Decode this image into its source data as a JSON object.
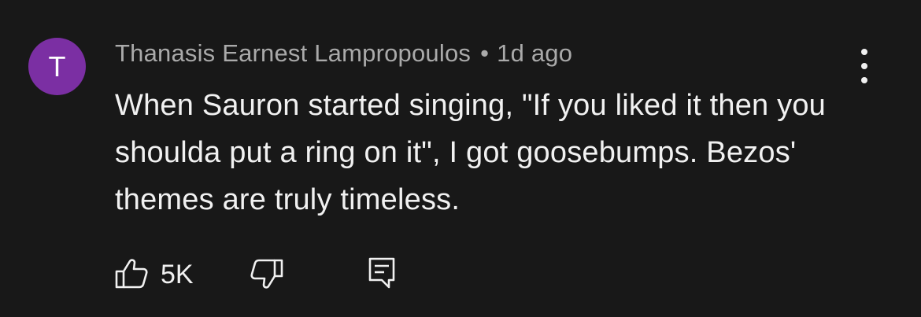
{
  "comment": {
    "avatar_initial": "T",
    "avatar_color": "#7b2fa3",
    "author": "Thanasis Earnest Lampropoulos",
    "separator": "•",
    "timestamp": "1d ago",
    "text": "When Sauron started singing, \"If you liked it then you shoulda put a ring on it\", I got goosebumps. Bezos' themes are truly timeless.",
    "like_count": "5K"
  },
  "icons": {
    "more": "more-vertical-icon",
    "like": "thumbs-up-icon",
    "dislike": "thumbs-down-icon",
    "reply": "comment-reply-icon"
  },
  "colors": {
    "background": "#181818",
    "text_primary": "#f1f1f1",
    "text_secondary": "#aaaaaa"
  }
}
